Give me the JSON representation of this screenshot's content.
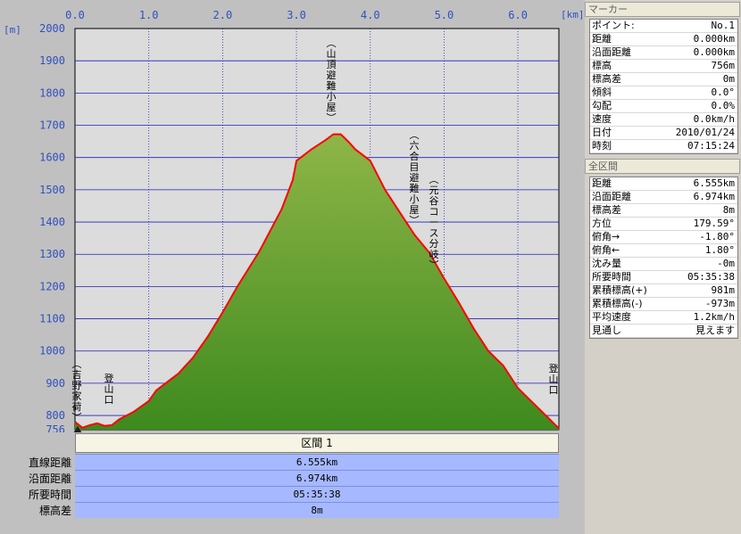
{
  "chart_data": {
    "type": "area",
    "x_unit": "[km]",
    "y_unit": "[m]",
    "xlim": [
      0,
      6.555
    ],
    "ylim": [
      756,
      2000
    ],
    "x_ticks": [
      "0.0",
      "1.0",
      "2.0",
      "3.0",
      "4.0",
      "5.0",
      "6.0"
    ],
    "y_ticks": [
      "2000",
      "1900",
      "1800",
      "1700",
      "1600",
      "1500",
      "1400",
      "1300",
      "1200",
      "1100",
      "1000",
      "900",
      "800",
      "756"
    ],
    "fill_color_top": "#8fb547",
    "fill_color_bottom": "#3e8a1e",
    "line_color": "#ff0000",
    "plot_background": "#dcdcdc",
    "grid_color": "#2020c0",
    "grid": true,
    "series": [
      {
        "x": [
          0.0,
          0.1,
          0.2,
          0.3,
          0.4,
          0.5,
          0.6,
          0.8,
          1.0,
          1.1,
          1.2,
          1.4,
          1.6,
          1.8,
          2.0,
          2.2,
          2.5,
          2.8,
          2.95,
          3.0,
          3.2,
          3.4,
          3.5,
          3.6,
          3.7,
          3.8,
          4.0,
          4.2,
          4.4,
          4.6,
          4.8,
          5.0,
          5.2,
          5.4,
          5.6,
          5.8,
          6.0,
          6.2,
          6.4,
          6.555
        ],
        "y": [
          780,
          762,
          770,
          776,
          768,
          770,
          788,
          812,
          845,
          878,
          895,
          930,
          980,
          1045,
          1120,
          1200,
          1310,
          1440,
          1530,
          1590,
          1625,
          1655,
          1672,
          1672,
          1650,
          1625,
          1590,
          1500,
          1430,
          1360,
          1305,
          1225,
          1150,
          1070,
          1000,
          955,
          885,
          840,
          795,
          760
        ]
      }
    ],
    "annotations": [
      {
        "label": "(吉野家荷)",
        "x": 0.0
      },
      {
        "label": "登山口",
        "x": 0.45
      },
      {
        "label": "(山頂避難小屋)",
        "x": 3.5
      },
      {
        "label": "(六合目避難小屋)",
        "x": 4.6
      },
      {
        "label": "(元谷コース分岐)",
        "x": 4.9
      },
      {
        "label": "登山口",
        "x": 6.48
      }
    ]
  },
  "segment": {
    "header": "区間 1",
    "rows": [
      {
        "label": "直線距離",
        "value": "6.555km"
      },
      {
        "label": "沿面距離",
        "value": "6.974km"
      },
      {
        "label": "所要時間",
        "value": "05:35:38"
      },
      {
        "label": "標高差",
        "value": "8m"
      }
    ]
  },
  "marker_panel": {
    "title": "マーカー",
    "rows": [
      {
        "k": "ポイント:",
        "v": "No.1"
      },
      {
        "k": "距離",
        "v": "0.000km"
      },
      {
        "k": "沿面距離",
        "v": "0.000km"
      },
      {
        "k": "標高",
        "v": "756m"
      },
      {
        "k": "標高差",
        "v": "0m"
      },
      {
        "k": "傾斜",
        "v": "0.0°"
      },
      {
        "k": "勾配",
        "v": "0.0%"
      },
      {
        "k": "速度",
        "v": "0.0km/h"
      },
      {
        "k": "日付",
        "v": "2010/01/24"
      },
      {
        "k": "時刻",
        "v": "07:15:24"
      }
    ]
  },
  "all_panel": {
    "title": "全区間",
    "rows": [
      {
        "k": "距離",
        "v": "6.555km"
      },
      {
        "k": "沿面距離",
        "v": "6.974km"
      },
      {
        "k": "標高差",
        "v": "8m"
      },
      {
        "k": "方位",
        "v": "179.59°"
      },
      {
        "k": "俯角→",
        "v": "-1.80°"
      },
      {
        "k": "俯角←",
        "v": "1.80°"
      },
      {
        "k": "沈み量",
        "v": "-0m"
      },
      {
        "k": "所要時間",
        "v": "05:35:38"
      },
      {
        "k": "累積標高(+)",
        "v": "981m"
      },
      {
        "k": "累積標高(-)",
        "v": "-973m"
      },
      {
        "k": "平均速度",
        "v": "1.2km/h"
      },
      {
        "k": "見通し",
        "v": "見えます"
      }
    ]
  }
}
